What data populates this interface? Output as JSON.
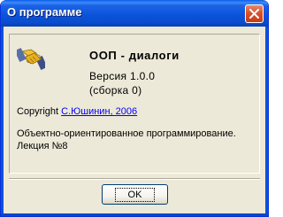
{
  "window": {
    "title": "О программе"
  },
  "about": {
    "product_name": "ООП - диалоги",
    "version": "Версия 1.0.0",
    "build": "(сборка 0)",
    "copyright_label": "Copyright",
    "copyright_link": "С.Юшинин, 2006",
    "description": "Объектно-ориентированное программирование. Лекция №8"
  },
  "buttons": {
    "ok_label": "OK"
  },
  "icons": {
    "close": "close-icon",
    "app": "handshake-icon"
  },
  "colors": {
    "titlebar": "#0a52d9",
    "dialog_background": "#ece9d8",
    "link": "#0000ff",
    "close_button": "#d9532c"
  }
}
